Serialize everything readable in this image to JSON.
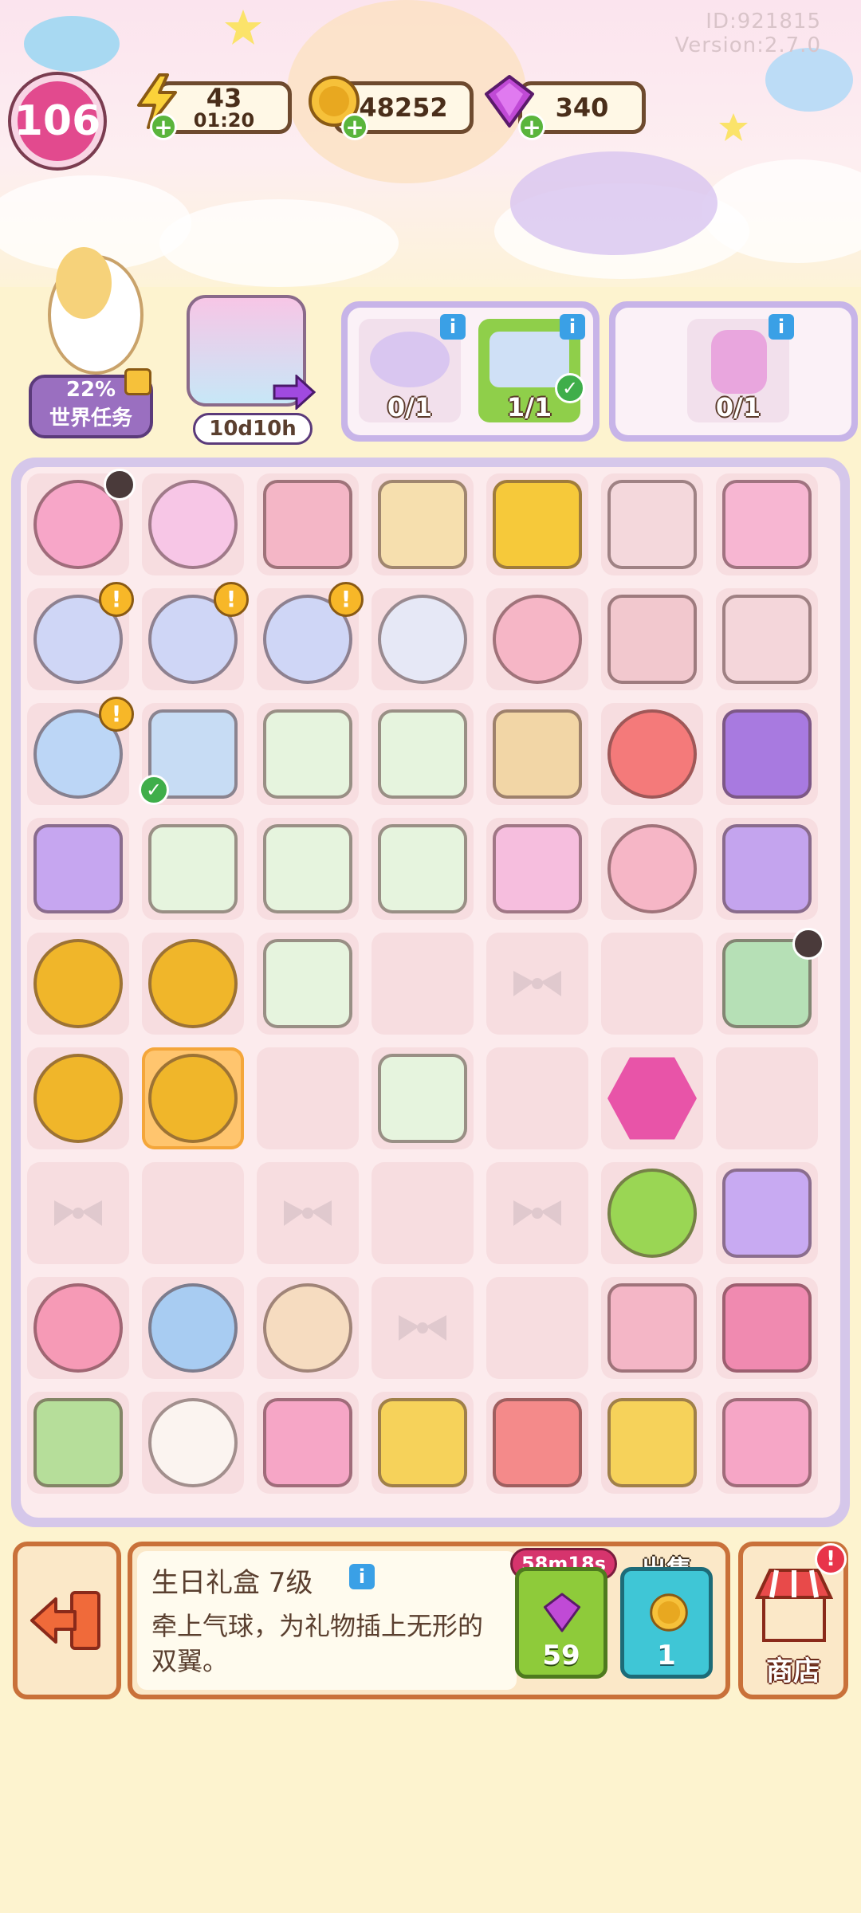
{
  "header": {
    "id_text": "ID:921815",
    "version_text": "Version:2.7.0",
    "level": "106",
    "energy": {
      "value": "43",
      "timer": "01:20",
      "icon": "lightning-icon"
    },
    "coins": {
      "value": "48252",
      "icon": "coin-icon"
    },
    "gems": {
      "value": "340",
      "icon": "gem-icon"
    }
  },
  "tasks": {
    "world_task": {
      "percent": "22%",
      "label": "世界任务"
    },
    "event": {
      "timer": "10d10h"
    },
    "orders_a": [
      {
        "count": "0/1",
        "completed": false
      },
      {
        "count": "1/1",
        "completed": true
      }
    ],
    "orders_b": [
      {
        "count": "0/1",
        "completed": false
      }
    ]
  },
  "board": {
    "rows": 9,
    "cols": 7,
    "items": [
      [
        "balloon-gift",
        "cotton-candy",
        "marshmallow",
        "butter-box",
        "golden-arrow-card",
        "nightstand",
        "vanity-set"
      ],
      [
        "glass-jar",
        "glass-jar",
        "glass-jar",
        "glass-jar-energy",
        "pink-roll",
        "drawer",
        "cabinet"
      ],
      [
        "blue-jar",
        "candy-box",
        "ticket",
        "ticket",
        "paper-scissors",
        "hamster-plush",
        "purple-skirt"
      ],
      [
        "purple-dress",
        "ticket",
        "ticket",
        "ticket",
        "candy-bag",
        "pink-roll",
        "purple-jacket"
      ],
      [
        "coin-pile-large",
        "coin-pile",
        "ticket",
        "empty",
        "locked",
        "empty",
        "shop-building"
      ],
      [
        "coin",
        "coin-stack",
        "empty",
        "ticket",
        "empty",
        "infinity-hex",
        "empty"
      ],
      [
        "locked",
        "empty",
        "locked",
        "empty",
        "locked",
        "lollipop",
        "purple-gown"
      ],
      [
        "bunny-plush",
        "cat-plush",
        "puppy-plush",
        "locked",
        "empty",
        "lint-roller",
        "cosmetics"
      ],
      [
        "map",
        "sheep-plush",
        "castle",
        "candy-arch",
        "carousel",
        "candy-arch",
        "castle"
      ]
    ],
    "selected": [
      5,
      1
    ]
  },
  "detail": {
    "name": "生日礼盒 7级",
    "description": "牵上气球，为礼物插上无形的双翼。",
    "speed_timer": "58m18s",
    "speed_cost": "59",
    "sell_label": "出售",
    "sell_price": "1"
  },
  "shop": {
    "label": "商店"
  },
  "colors": {
    "accent": "#e24a8e",
    "board": "#d5c7ea",
    "panel": "#c9713a"
  }
}
